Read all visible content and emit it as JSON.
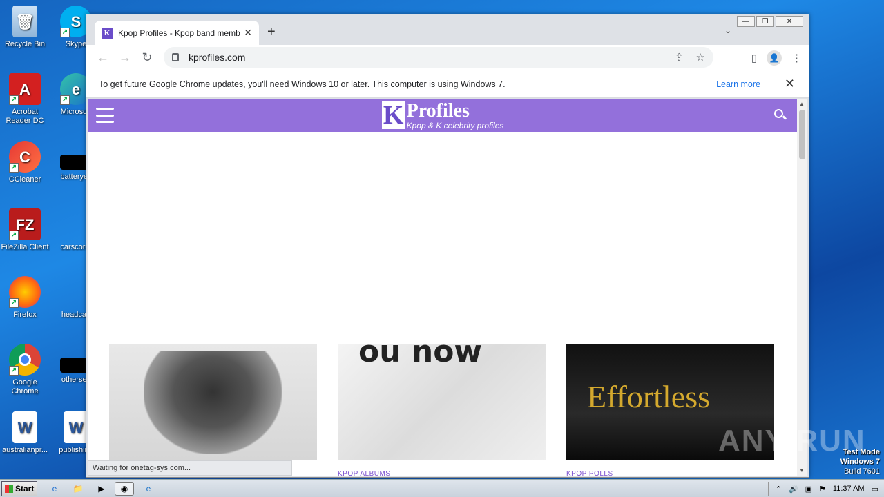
{
  "desktop": {
    "icons": [
      {
        "label": "Recycle Bin"
      },
      {
        "label": "Skype"
      },
      {
        "label": "Acrobat Reader DC"
      },
      {
        "label": "Microsoft"
      },
      {
        "label": "CCleaner"
      },
      {
        "label": "batteryey"
      },
      {
        "label": "FileZilla Client"
      },
      {
        "label": "carscore."
      },
      {
        "label": "Firefox"
      },
      {
        "label": "headcar."
      },
      {
        "label": "Google Chrome"
      },
      {
        "label": "othersev"
      },
      {
        "label": "australianpr..."
      },
      {
        "label": "publishing"
      }
    ]
  },
  "browser": {
    "tab_title": "Kpop Profiles - Kpop band member p",
    "tab_favicon": "K",
    "url": "kprofiles.com",
    "infobar_text": "To get future Google Chrome updates, you'll need Windows 10 or later. This computer is using Windows 7.",
    "learn_more": "Learn more",
    "status": "Waiting for onetag-sys.com..."
  },
  "site": {
    "logo_letter": "K",
    "logo_name": "Profiles",
    "logo_tagline": "Kpop & K celebrity profiles",
    "cards": [
      {
        "category": "",
        "image_text": ""
      },
      {
        "category": "KPOP ALBUMS",
        "image_text": "ou now"
      },
      {
        "category": "KPOP POLLS",
        "image_text": "Effortless"
      }
    ]
  },
  "overlay": {
    "watermark": "ANY RUN",
    "test_mode_line1": "Test Mode",
    "test_mode_line2": "Windows 7",
    "test_mode_line3": "Build 7601"
  },
  "taskbar": {
    "start_label": "Start",
    "clock": "11:37 AM"
  },
  "colors": {
    "site_header": "#9370db",
    "link": "#1a73e8",
    "category": "#7b4fcf"
  }
}
